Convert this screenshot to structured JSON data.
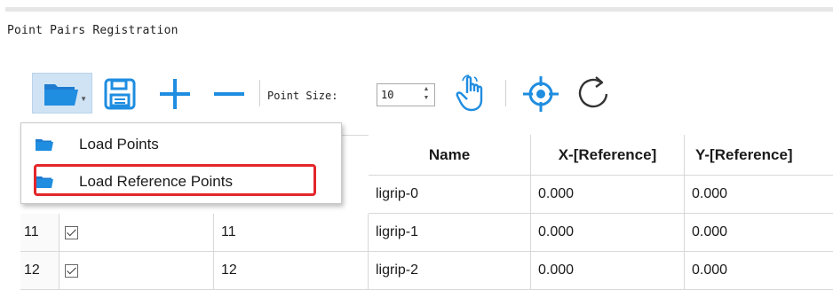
{
  "window": {
    "title": "Point Pairs Registration"
  },
  "toolbar": {
    "point_size_label": "Point Size:",
    "point_size_value": "10",
    "icons": [
      "open-folder-icon",
      "save-icon",
      "plus-icon",
      "minus-icon",
      "hand-pointer-icon",
      "crosshair-icon",
      "refresh-icon"
    ]
  },
  "menu": {
    "items": [
      {
        "label": "Load Points"
      },
      {
        "label": "Load Reference Points"
      }
    ]
  },
  "table": {
    "columns": [
      "Name",
      "X-[Reference]",
      "Y-[Reference]"
    ],
    "rows": [
      {
        "row_number": "",
        "id": "",
        "name": "ligrip-0",
        "x_ref": "0.000",
        "y_ref": "0.000"
      },
      {
        "row_number": "11",
        "id": "11",
        "name": "ligrip-1",
        "x_ref": "0.000",
        "y_ref": "0.000"
      },
      {
        "row_number": "12",
        "id": "12",
        "name": "ligrip-2",
        "x_ref": "0.000",
        "y_ref": "0.000"
      }
    ]
  },
  "colors": {
    "accent_blue": "#1f8de0",
    "highlight_red": "#e3262a",
    "folder_blue": "#1e7bd0"
  }
}
